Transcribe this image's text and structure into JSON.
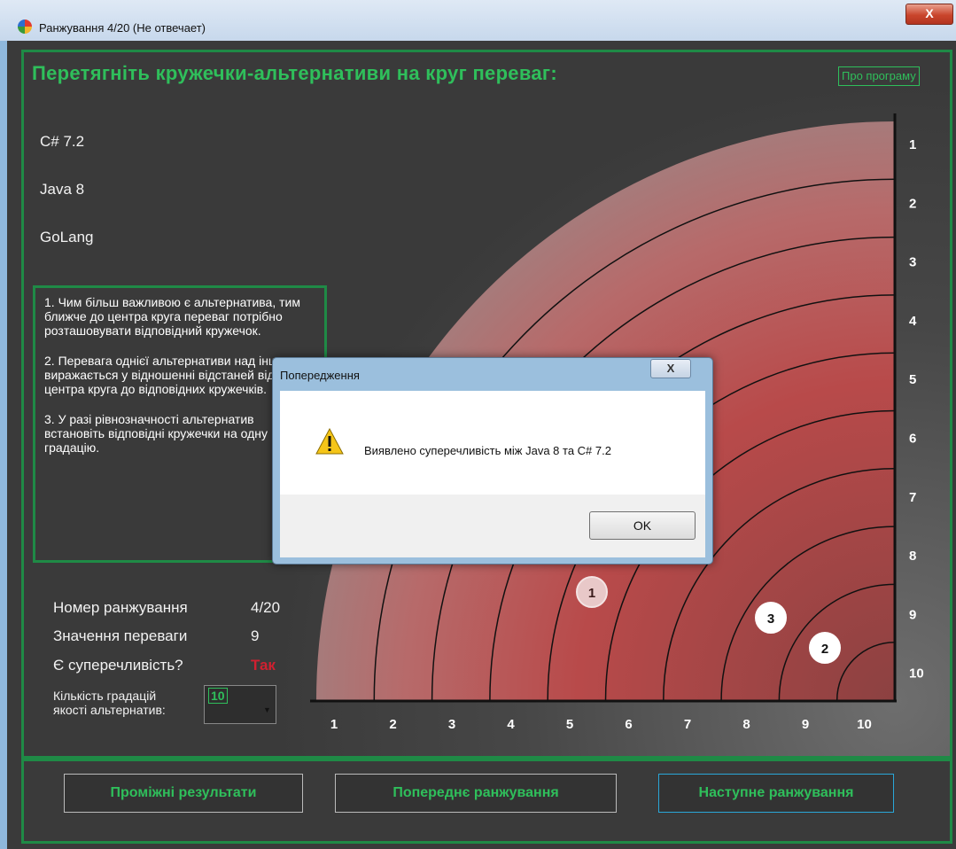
{
  "window": {
    "title": "Ранжування 4/20 (Не отвечает)",
    "close_label": "X"
  },
  "heading": "Перетягніть кружечки-альтернативи на круг переваг:",
  "about_label": "Про програму",
  "alternatives": [
    "C# 7.2",
    "Java 8",
    "GoLang"
  ],
  "rules": [
    "1. Чим більш важливою є альтернатива, тим ближче до центра круга переваг потрібно розташовувати відповідний кружечок.",
    "2. Перевага однієї альтернативи над іншою виражається у відношенні відстаней від центра круга до відповідних кружечків.",
    "3. У разі рівнозначності альтернатив встановіть відповідні кружечки на одну градацію."
  ],
  "info": {
    "rank_label": "Номер ранжування",
    "rank_value": "4/20",
    "pref_label": "Значення переваги",
    "pref_value": "9",
    "contra_label": "Є суперечливість?",
    "contra_value": "Так",
    "grad_label_1": "Кількість градацій",
    "grad_label_2": "якості альтернатив:",
    "grad_value": "10"
  },
  "axis_ticks": [
    "1",
    "2",
    "3",
    "4",
    "5",
    "6",
    "7",
    "8",
    "9",
    "10"
  ],
  "circles": [
    {
      "label": "1",
      "grade": 5.5
    },
    {
      "label": "3",
      "grade": 8.5
    },
    {
      "label": "2",
      "grade": 9.4
    }
  ],
  "buttons": {
    "intermediate": "Проміжні результати",
    "previous": "Попереднє ранжування",
    "next": "Наступне ранжування"
  },
  "dialog": {
    "title": "Попередження",
    "close_label": "X",
    "message": "Виявлено суперечливість між Java 8 та C# 7.2",
    "ok_label": "OK"
  },
  "colors": {
    "accent_green": "#2fbf5b",
    "warning_red": "#d02030",
    "next_border": "#2aa7d8"
  }
}
